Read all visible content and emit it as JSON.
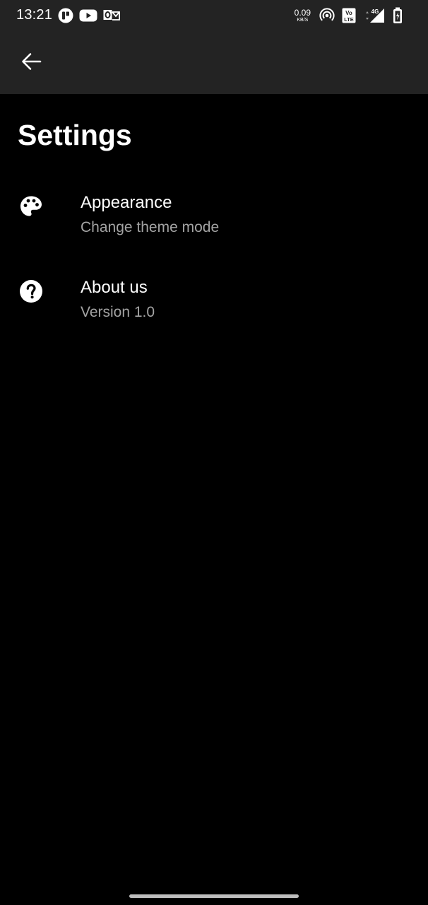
{
  "status_bar": {
    "time": "13:21",
    "net_speed_value": "0.09",
    "net_speed_unit": "KB/S",
    "network_type": "4G",
    "volte_label_top": "Vo",
    "volte_label_bottom": "LTE",
    "notification_icons": [
      "tasks-app-icon",
      "youtube-icon",
      "outlook-icon"
    ],
    "system_icons": [
      "hotspot-icon",
      "volte-icon",
      "signal-icon",
      "battery-icon"
    ]
  },
  "app_bar": {
    "back_icon": "arrow-left-icon"
  },
  "page": {
    "title": "Settings"
  },
  "settings": {
    "items": [
      {
        "icon": "palette-icon",
        "title": "Appearance",
        "subtitle": "Change theme mode"
      },
      {
        "icon": "help-circle-icon",
        "title": "About us",
        "subtitle": "Version 1.0"
      }
    ]
  },
  "colors": {
    "background": "#000000",
    "app_bar": "#232323",
    "text_primary": "#ffffff",
    "text_secondary": "#a3a3a3"
  }
}
